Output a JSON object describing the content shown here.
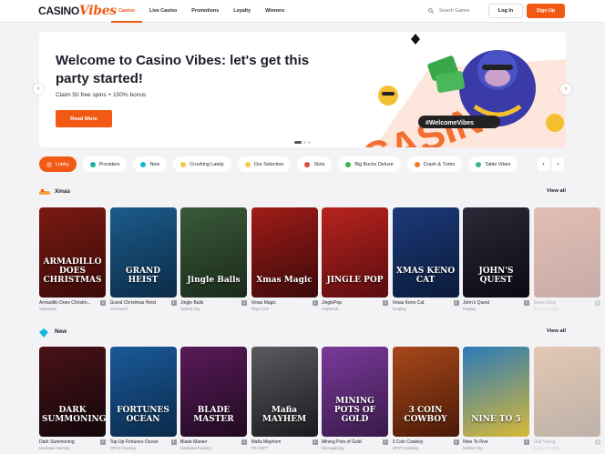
{
  "brand": {
    "part1": "CASINO",
    "part2": "Vibes"
  },
  "nav": [
    {
      "label": "Casino",
      "active": true
    },
    {
      "label": "Live Casino",
      "active": false
    },
    {
      "label": "Promotions",
      "active": false
    },
    {
      "label": "Loyalty",
      "active": false
    },
    {
      "label": "Winners",
      "active": false
    }
  ],
  "search": {
    "placeholder": "Search Games",
    "icon": "search-icon"
  },
  "auth": {
    "login": "Log In",
    "signup": "Sign Up"
  },
  "hero": {
    "title": "Welcome to Casino Vibes: let's get this party started!",
    "subtitle": "Claim 50 free spins + 150% bonus",
    "cta": "Read More",
    "art_text": "#WelcomeVibes",
    "art_brand": "CASINO"
  },
  "categories": [
    {
      "label": "Lobby",
      "active": true,
      "color": "#f25a14"
    },
    {
      "label": "Providers",
      "color": "#19b4a4"
    },
    {
      "label": "New",
      "color": "#19b4d6"
    },
    {
      "label": "Crushing Lately",
      "color": "#f5c84a"
    },
    {
      "label": "Our Selection",
      "color": "#f5c84a"
    },
    {
      "label": "Slots",
      "color": "#e44848"
    },
    {
      "label": "Big Bucks Deluxe",
      "color": "#3ab54a"
    },
    {
      "label": "Crash & Turbo",
      "color": "#f27a2a"
    },
    {
      "label": "Table Vibes",
      "color": "#3ab58a"
    }
  ],
  "sections": {
    "xmas": {
      "title": "Xmas",
      "view_all": "View all",
      "games": [
        {
          "name": "Armadillo Does Christm...",
          "provider": "Slotmatrix",
          "art": "ARMADILLO DOES CHRISTMAS",
          "c1": "#7a1a12",
          "c2": "#3a0a08"
        },
        {
          "name": "Grand Christmas Heist",
          "provider": "OneTouch",
          "art": "GRAND HEIST",
          "c1": "#1b5c8a",
          "c2": "#0c2a48"
        },
        {
          "name": "Jingle Balls",
          "provider": "Nolimit City",
          "art": "Jingle Balls",
          "c1": "#3a5a3a",
          "c2": "#1a2a1a"
        },
        {
          "name": "Xmas Magic",
          "provider": "Play'n GO",
          "art": "Xmas Magic",
          "c1": "#a11c18",
          "c2": "#3a0a0a"
        },
        {
          "name": "JinglePop",
          "provider": "AvatarUX",
          "art": "JINGLE POP",
          "c1": "#b8241e",
          "c2": "#5a0c10"
        },
        {
          "name": "Xmas Keno Cat",
          "provider": "Evoplay",
          "art": "XMAS KENO CAT",
          "c1": "#1c3a7a",
          "c2": "#0a1a3a"
        },
        {
          "name": "John's Quest",
          "provider": "Petplay",
          "art": "JOHN'S QUEST",
          "c1": "#2a2a38",
          "c2": "#0a0a14"
        },
        {
          "name": "Snow Drop",
          "provider": "Some Provider",
          "art": "",
          "c1": "#c25a38",
          "c2": "#7a2a1a"
        }
      ]
    },
    "new": {
      "title": "New",
      "view_all": "View all",
      "games": [
        {
          "name": "Dark Summoning",
          "provider": "Hacksaw Gaming",
          "art": "DARK SUMMONING",
          "c1": "#4a1218",
          "c2": "#12060a"
        },
        {
          "name": "Top Up Fortunes Ocean",
          "provider": "ORYX Gaming",
          "art": "FORTUNES OCEAN",
          "c1": "#1a5a9a",
          "c2": "#0a2a4a"
        },
        {
          "name": "Blade Master",
          "provider": "Hacksaw Gaming",
          "art": "BLADE MASTER",
          "c1": "#5a1a5a",
          "c2": "#200a20"
        },
        {
          "name": "Mafia Mayhem",
          "provider": "PG SOFT",
          "art": "Mafia MAYHEM",
          "c1": "#5a5a60",
          "c2": "#1a1a1e"
        },
        {
          "name": "Mining Pots of Gold",
          "provider": "Microgaming",
          "art": "MINING POTS OF GOLD",
          "c1": "#7a3a9a",
          "c2": "#3a1a4a"
        },
        {
          "name": "3 Coin Cowboy",
          "provider": "ORYX Gaming",
          "art": "3 COIN COWBOY",
          "c1": "#a8481a",
          "c2": "#4a1a08"
        },
        {
          "name": "Nine To Five",
          "provider": "Nolimit City",
          "art": "NINE TO 5",
          "c1": "#2a7ab8",
          "c2": "#d8b838"
        },
        {
          "name": "Olaf Viking",
          "provider": "Some Provider",
          "art": "",
          "c1": "#c87a3a",
          "c2": "#5a3a1a"
        }
      ]
    }
  },
  "colors": {
    "accent": "#f25a14",
    "bg": "#f3f3f6"
  }
}
